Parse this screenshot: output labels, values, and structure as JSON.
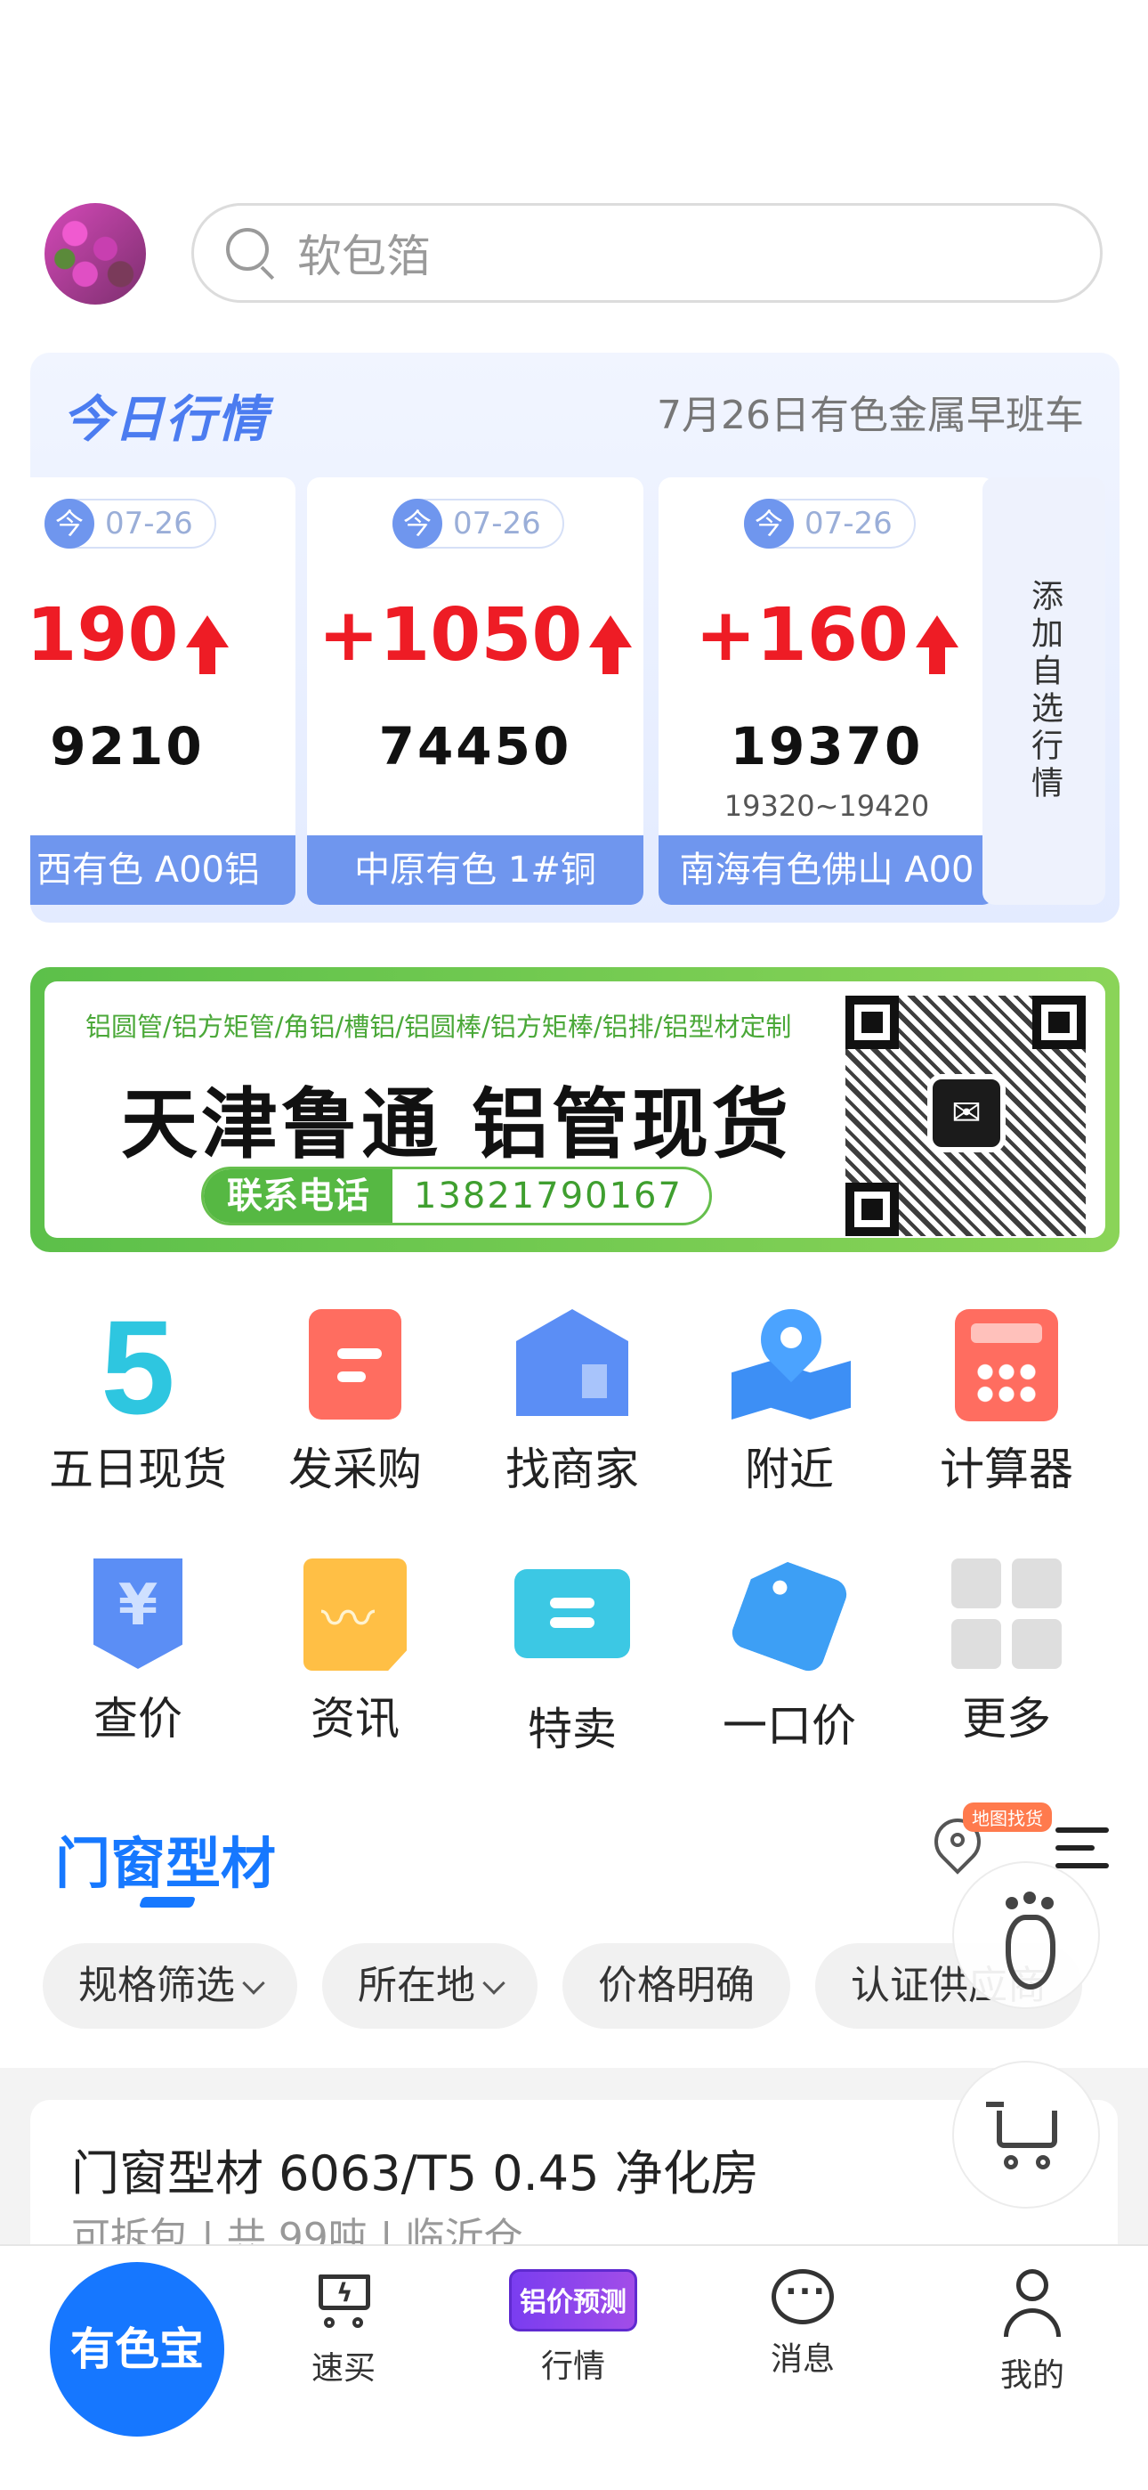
{
  "search": {
    "placeholder": "软包箔"
  },
  "market": {
    "title": "今日行情",
    "subtitle": "7月26日有色金属早班车",
    "badge_char": "今",
    "cards": [
      {
        "date": "07-26",
        "change": "190",
        "price": "9210",
        "range": "",
        "name": "西有色 A00铝"
      },
      {
        "date": "07-26",
        "change": "+1050",
        "price": "74450",
        "range": "",
        "name": "中原有色 1#铜"
      },
      {
        "date": "07-26",
        "change": "+160",
        "price": "19370",
        "range": "19320~19420",
        "name": "南海有色佛山 A00"
      }
    ],
    "add_label": "添加自选行情"
  },
  "banner": {
    "top_text": "铝圆管/铝方矩管/角铝/槽铝/铝圆棒/铝方矩棒/铝排/铝型材定制",
    "title": "天津鲁通 铝管现货",
    "phone_label": "联系电话",
    "phone": "13821790167"
  },
  "grid": {
    "row1": [
      {
        "label": "五日现货",
        "icon": "five-day-icon",
        "glyph": "5"
      },
      {
        "label": "发采购",
        "icon": "purchase-icon"
      },
      {
        "label": "找商家",
        "icon": "merchant-icon"
      },
      {
        "label": "附近",
        "icon": "nearby-icon"
      },
      {
        "label": "计算器",
        "icon": "calculator-icon"
      }
    ],
    "row2": [
      {
        "label": "查价",
        "icon": "price-check-icon",
        "glyph": "¥"
      },
      {
        "label": "资讯",
        "icon": "news-icon"
      },
      {
        "label": "特卖",
        "icon": "special-sale-icon"
      },
      {
        "label": "一口价",
        "icon": "fixed-price-icon"
      },
      {
        "label": "更多",
        "icon": "more-icon"
      }
    ]
  },
  "category": {
    "title": "门窗型材",
    "map_badge": "地图找货",
    "filters": [
      "规格筛选",
      "所在地",
      "价格明确",
      "认证供应商"
    ]
  },
  "product": {
    "title": "门窗型材 6063/T5 0.45 净化房",
    "meta": "可拆包 | 共 99吨 | 临沂仓"
  },
  "tabbar": {
    "brand": "有色宝",
    "tabs": [
      {
        "label": "速买",
        "icon": "quick-buy-icon"
      },
      {
        "label": "行情",
        "icon": "price-forecast-icon",
        "badge": "铝价预测"
      },
      {
        "label": "消息",
        "icon": "message-icon"
      },
      {
        "label": "我的",
        "icon": "profile-icon"
      }
    ]
  },
  "colors": {
    "accent": "#1677ff",
    "up": "#ee1c25",
    "card_blue": "#6f96ee",
    "banner_green": "#5cc04a"
  }
}
